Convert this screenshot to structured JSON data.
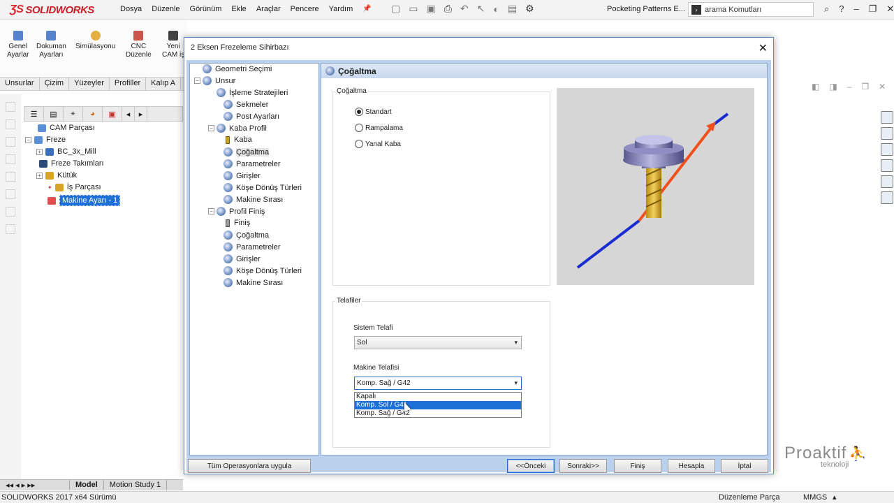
{
  "app": {
    "brand": "SOLIDWORKS",
    "menus": [
      "Dosya",
      "Düzenle",
      "Görünüm",
      "Ekle",
      "Araçlar",
      "Pencere",
      "Yardım"
    ],
    "doc_title": "Pocketing Patterns E...",
    "command_search_placeholder": "arama Komutları"
  },
  "ribbon": {
    "buttons": [
      {
        "line1": "Genel",
        "line2": "Ayarlar",
        "icon": "settings-doc-icon",
        "color": "#3a6fc4"
      },
      {
        "line1": "Dokuman",
        "line2": "Ayarları",
        "icon": "document-settings-icon",
        "color": "#3a6fc4"
      },
      {
        "line1": "Simülasyonu",
        "line2": "",
        "icon": "simulation-icon",
        "color": "#e0a020"
      },
      {
        "line1": "CNC",
        "line2": "Düzenle",
        "icon": "cnc-gear-icon",
        "color": "#c0392b"
      },
      {
        "line1": "Yeni",
        "line2": "CAM iş",
        "icon": "new-cam-icon",
        "color": "#222222"
      }
    ],
    "tabs": [
      "Unsurlar",
      "Çizim",
      "Yüzeyler",
      "Profiller",
      "Kalıp A"
    ]
  },
  "feature_tree": {
    "items": [
      {
        "label": "CAM Parçası",
        "icon": "cam-part-icon",
        "color": "#5b8fd6",
        "expander": ""
      },
      {
        "label": "Freze",
        "icon": "mill-icon",
        "color": "#5b8fd6",
        "expander": "−"
      },
      {
        "label": "BC_3x_Mill",
        "icon": "machine-icon",
        "color": "#3b6fbf",
        "expander": "+"
      },
      {
        "label": "Freze Takımları",
        "icon": "tool-icon",
        "color": "#2a4a7a",
        "expander": ""
      },
      {
        "label": "Kütük",
        "icon": "stock-icon",
        "color": "#d9a42a",
        "expander": "+"
      },
      {
        "label": "İş Parçası",
        "icon": "workpiece-icon",
        "color": "#d9a42a",
        "expander": ""
      },
      {
        "label": "Makine Ayarı - 1",
        "icon": "machine-setup-icon",
        "color": "#e05050",
        "expander": ""
      }
    ],
    "bottom_tabs": [
      "Model",
      "Motion Study 1"
    ]
  },
  "dialog": {
    "title": "2 Eksen Frezeleme Sihirbazı",
    "nav": [
      {
        "label": "Geometri Seçimi",
        "level": 1,
        "kind": "globe",
        "expander": ""
      },
      {
        "label": "Unsur",
        "level": 0,
        "kind": "globe",
        "expander": "−"
      },
      {
        "label": "İşleme Stratejileri",
        "level": 2,
        "kind": "globe",
        "expander": ""
      },
      {
        "label": "Sekmeler",
        "level": 2,
        "kind": "globe",
        "expander": ""
      },
      {
        "label": "Post Ayarları",
        "level": 2,
        "kind": "globe",
        "expander": ""
      },
      {
        "label": "Kaba Profil",
        "level": 1,
        "kind": "globe",
        "expander": "−"
      },
      {
        "label": "Kaba",
        "level": 3,
        "kind": "bit-gold",
        "expander": ""
      },
      {
        "label": "Çoğaltma",
        "level": 3,
        "kind": "globe",
        "expander": "",
        "selected": true
      },
      {
        "label": "Parametreler",
        "level": 3,
        "kind": "globe",
        "expander": ""
      },
      {
        "label": "Girişler",
        "level": 3,
        "kind": "globe",
        "expander": ""
      },
      {
        "label": "Köşe Dönüş Türleri",
        "level": 3,
        "kind": "globe",
        "expander": ""
      },
      {
        "label": "Makine Sırası",
        "level": 3,
        "kind": "globe",
        "expander": ""
      },
      {
        "label": "Profil Finiş",
        "level": 1,
        "kind": "globe",
        "expander": "−"
      },
      {
        "label": "Finiş",
        "level": 3,
        "kind": "bit-grey",
        "expander": ""
      },
      {
        "label": "Çoğaltma",
        "level": 3,
        "kind": "globe",
        "expander": ""
      },
      {
        "label": "Parametreler",
        "level": 3,
        "kind": "globe",
        "expander": ""
      },
      {
        "label": "Girişler",
        "level": 3,
        "kind": "globe",
        "expander": ""
      },
      {
        "label": "Köşe Dönüş Türleri",
        "level": 3,
        "kind": "globe",
        "expander": ""
      },
      {
        "label": "Makine Sırası",
        "level": 3,
        "kind": "globe",
        "expander": ""
      }
    ],
    "page_title": "Çoğaltma",
    "pattern_group": {
      "label": "Çoğaltma",
      "options": [
        "Standart",
        "Rampalama",
        "Yanal Kaba"
      ],
      "selected_index": 0
    },
    "comp_group": {
      "label": "Telafiler",
      "system_label": "Sistem Telafi",
      "system_value": "Sol",
      "machine_label": "Makine Telafisi",
      "machine_value": "Komp. Sağ / G42",
      "machine_options": [
        "Kapalı",
        "Komp. Sol / G41",
        "Komp. Sağ / G42"
      ],
      "highlighted_index": 1
    },
    "buttons": {
      "apply_all": "Tüm Operasyonlara uygula",
      "prev": "<<Önceki",
      "next": "Sonraki>>",
      "finish": "Finiş",
      "compute": "Hesapla",
      "cancel": "İptal"
    }
  },
  "statusbar": {
    "left": "SOLIDWORKS 2017 x64 Sürümü",
    "mode": "Düzenleme Parça",
    "units": "MMGS"
  },
  "watermark": {
    "brand": "Proaktif",
    "tagline": "teknoloji"
  }
}
